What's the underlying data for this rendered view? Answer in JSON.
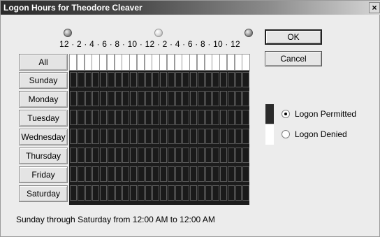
{
  "window": {
    "title": "Logon Hours for Theodore Cleaver",
    "close_glyph": "×"
  },
  "clock_icons": [
    "sun-moon-dark-icon",
    "sun-light-icon",
    "sun-moon-dark-icon"
  ],
  "hours_scale": "12 · 2 · 4 · 6 · 8 · 10 · 12 · 2 · 4 · 6 · 8 · 10 · 12",
  "grid": {
    "all_label": "All",
    "days": [
      "Sunday",
      "Monday",
      "Tuesday",
      "Wednesday",
      "Thursday",
      "Friday",
      "Saturday"
    ],
    "hours_per_day": 24,
    "state": "permitted"
  },
  "buttons": {
    "ok": "OK",
    "cancel": "Cancel"
  },
  "legend": {
    "permitted_label": "Logon Permitted",
    "denied_label": "Logon Denied",
    "selected": "permitted",
    "permitted_color": "#2a2a2a",
    "denied_color": "#ffffff"
  },
  "status_text": "Sunday through Saturday from 12:00 AM to 12:00 AM"
}
